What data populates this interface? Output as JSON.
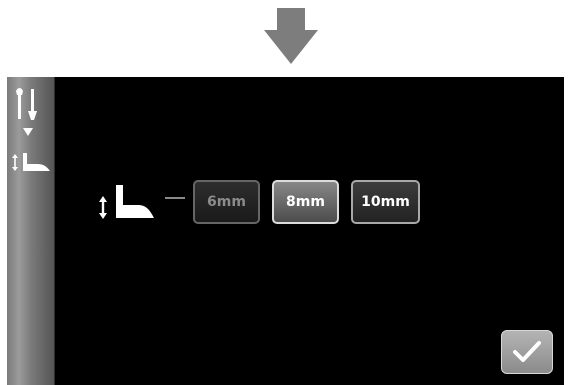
{
  "presser_foot_height_options": [
    {
      "label": "6mm",
      "state": "disabled"
    },
    {
      "label": "8mm",
      "state": "selected"
    },
    {
      "label": "10mm",
      "state": "normal"
    }
  ],
  "icons": {
    "top_arrow": "down-arrow-icon",
    "sidebar_tools": "tools-icon",
    "sidebar_arrow": "down-triangle-icon",
    "sidebar_presser": "presser-foot-height-icon",
    "presser_foot": "presser-foot-height-icon",
    "confirm": "checkmark-icon"
  },
  "colors": {
    "screen_background": "#000000",
    "sidebar_gray": "#7b7b7b",
    "arrow_gray": "#7d7d7d",
    "button_text": "#ffffff",
    "disabled_text": "#8b8b8b"
  }
}
